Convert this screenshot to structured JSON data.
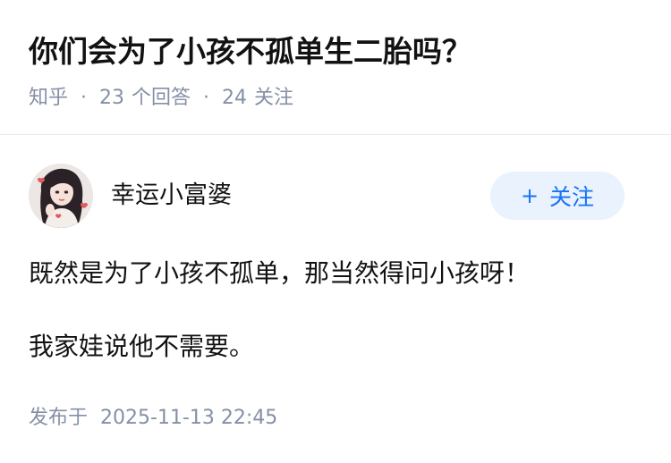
{
  "question": {
    "title": "你们会为了小孩不孤单生二胎吗？",
    "source": "知乎",
    "answer_count": "23",
    "answer_label": "个回答",
    "follower_count": "24",
    "follower_label": "关注",
    "separator": "·"
  },
  "answer": {
    "author": {
      "name": "幸运小富婆",
      "avatar_icon": "avatar-portrait-icon"
    },
    "follow_button": {
      "plus": "+",
      "label": "关注"
    },
    "paragraphs": [
      "既然是为了小孩不孤单，那当然得问小孩呀！",
      "我家娃说他不需要。"
    ],
    "published_label": "发布于",
    "published_time": "2025-11-13 22:45"
  },
  "colors": {
    "text": "#121212",
    "meta": "#8590a6",
    "brand": "#1772f6",
    "follow_bg": "#e9f2fd",
    "divider": "#ebebeb"
  }
}
